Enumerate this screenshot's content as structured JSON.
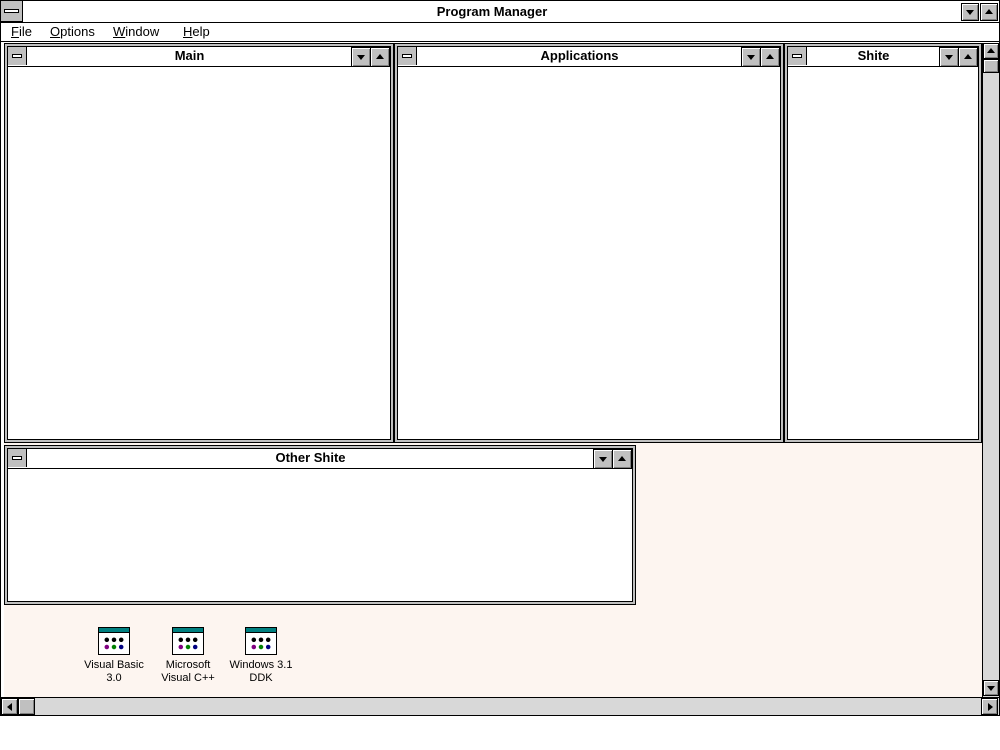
{
  "window": {
    "title": "Program Manager"
  },
  "menu": {
    "file": {
      "mnemonic": "F",
      "rest": "ile"
    },
    "options": {
      "mnemonic": "O",
      "rest": "ptions"
    },
    "window": {
      "mnemonic": "W",
      "rest": "indow"
    },
    "help": {
      "mnemonic": "H",
      "rest": "elp"
    }
  },
  "groups": {
    "main": {
      "title": "Main"
    },
    "applications": {
      "title": "Applications"
    },
    "shite": {
      "title": "Shite"
    },
    "other_shite": {
      "title": "Other Shite"
    }
  },
  "icons": {
    "vb": {
      "line1": "Visual Basic",
      "line2": "3.0"
    },
    "vcpp": {
      "line1": "Microsoft",
      "line2": "Visual C++"
    },
    "ddk": {
      "line1": "Windows 3.1",
      "line2": "DDK"
    }
  },
  "colors": {
    "desktop_background": "#fdf5f0",
    "chrome_gray": "#c0c0c0",
    "icon_header": "#008080"
  },
  "icon_names": {
    "system_menu": "system-menu-icon",
    "minimize": "minimize-arrow-icon",
    "maximize": "maximize-arrow-icon",
    "program_group": "program-group-icon"
  }
}
